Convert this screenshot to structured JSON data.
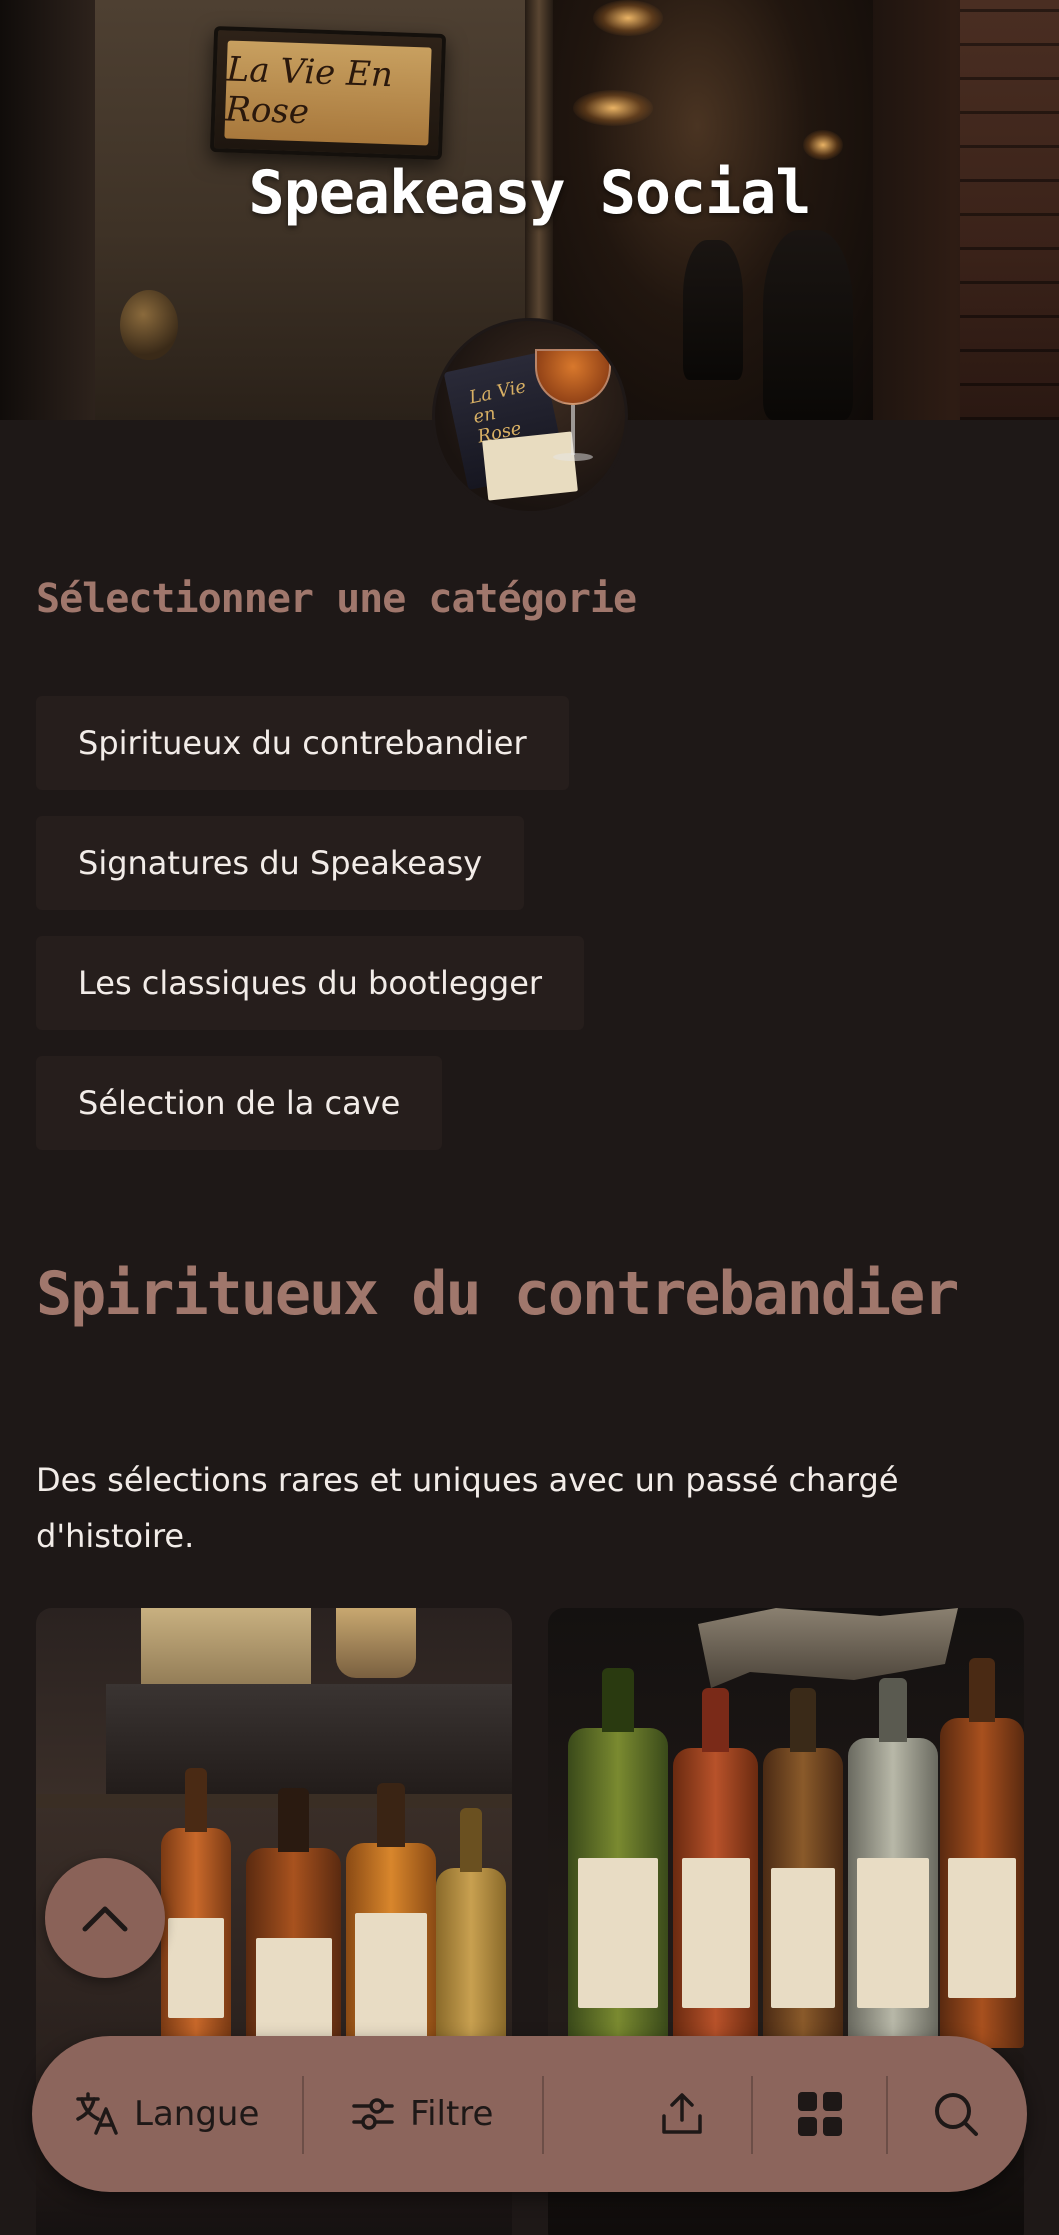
{
  "header": {
    "title": "Speakeasy Social",
    "sign_text": "La Vie En Rose",
    "avatar_menu_text": "La Vie en Rose"
  },
  "categories": {
    "label": "Sélectionner une catégorie",
    "items": [
      {
        "label": "Spiritueux du contrebandier"
      },
      {
        "label": "Signatures du Speakeasy"
      },
      {
        "label": "Les classiques du bootlegger"
      },
      {
        "label": "Sélection de la cave"
      }
    ]
  },
  "active_category": {
    "title": "Spiritueux du contrebandier",
    "description": "Des sélections rares et uniques avec un passé chargé d'histoire."
  },
  "bottom_bar": {
    "language_label": "Langue",
    "filter_label": "Filtre",
    "icons": [
      "translate-icon",
      "filter-icon",
      "share-icon",
      "grid-icon",
      "search-icon"
    ]
  },
  "colors": {
    "background": "#1e1817",
    "accent": "#a0776c",
    "chip_background": "#261e1c",
    "bar_background": "#8c655c",
    "text": "#f2ece8"
  }
}
